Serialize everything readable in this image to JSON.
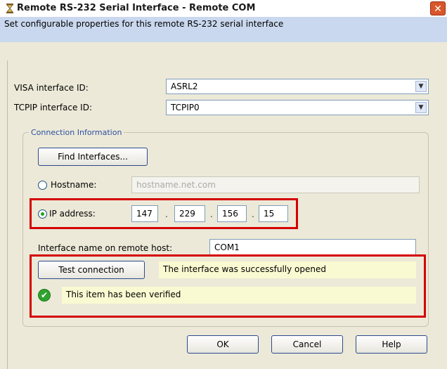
{
  "window": {
    "title": "Remote RS-232 Serial Interface - Remote COM",
    "close_glyph": "✕",
    "banner_text": "Set configurable properties for this  remote RS-232 serial interface"
  },
  "form": {
    "visa_label": "VISA interface ID:",
    "visa_value": "ASRL2",
    "tcpip_label": "TCPIP interface ID:",
    "tcpip_value": "TCPIP0",
    "dropdown_glyph": "▼"
  },
  "connection": {
    "group_title": "Connection Information",
    "find_button": "Find Interfaces...",
    "hostname_label": "Hostname:",
    "hostname_placeholder": "hostname.net.com",
    "hostname_selected": false,
    "ip_label": "IP address:",
    "ip_selected": true,
    "ip_octets": [
      "147",
      "229",
      "156",
      "15"
    ],
    "ip_separator": ".",
    "remote_name_label": "Interface name on remote host:",
    "remote_name_value": "COM1"
  },
  "test": {
    "button": "Test connection",
    "result": "The interface was successfully opened",
    "verified_text": "This item has been verified",
    "verified_glyph": "✔"
  },
  "footer": {
    "ok": "OK",
    "cancel": "Cancel",
    "help": "Help"
  },
  "colors": {
    "highlight": "#d40000",
    "success": "#2fa32f",
    "banner": "#c9d8ee"
  }
}
